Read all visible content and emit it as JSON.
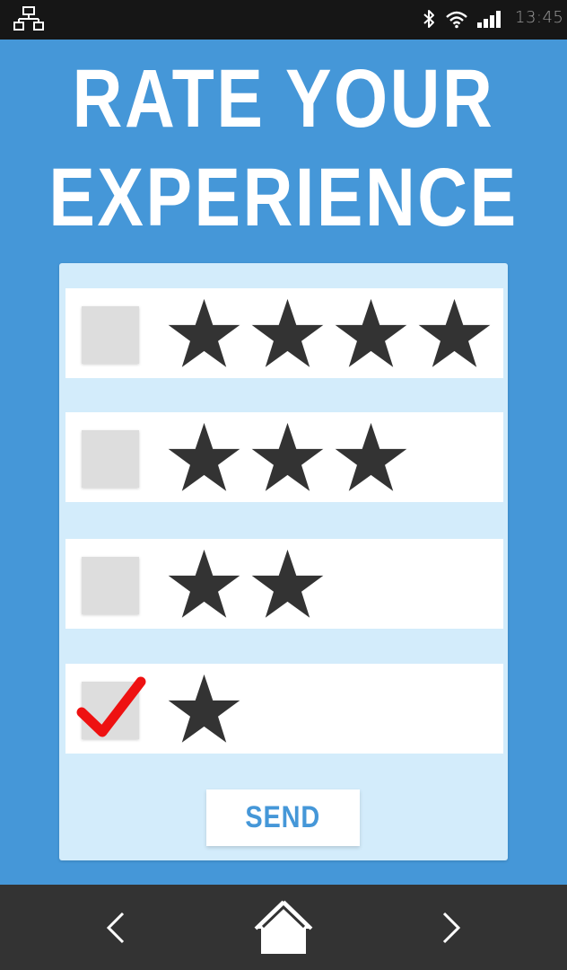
{
  "status_bar": {
    "time": "13:45",
    "icons": [
      "network-icon",
      "bluetooth-icon",
      "wifi-icon",
      "signal-icon"
    ]
  },
  "title": {
    "line1": "RATE YOUR",
    "line2": "EXPERIENCE"
  },
  "colors": {
    "background": "#4597d8",
    "card": "#d3ecfb",
    "row": "#ffffff",
    "checkbox": "#dddddd",
    "star": "#333333",
    "checkmark": "#ee1111",
    "nav_bar": "#333333",
    "status_bar": "#161616"
  },
  "ratings": [
    {
      "stars": 4,
      "checked": false
    },
    {
      "stars": 3,
      "checked": false
    },
    {
      "stars": 2,
      "checked": false
    },
    {
      "stars": 1,
      "checked": true
    }
  ],
  "send_button": {
    "label": "SEND"
  },
  "nav_bar": {
    "icons": [
      "back-icon",
      "home-icon",
      "forward-icon"
    ]
  }
}
